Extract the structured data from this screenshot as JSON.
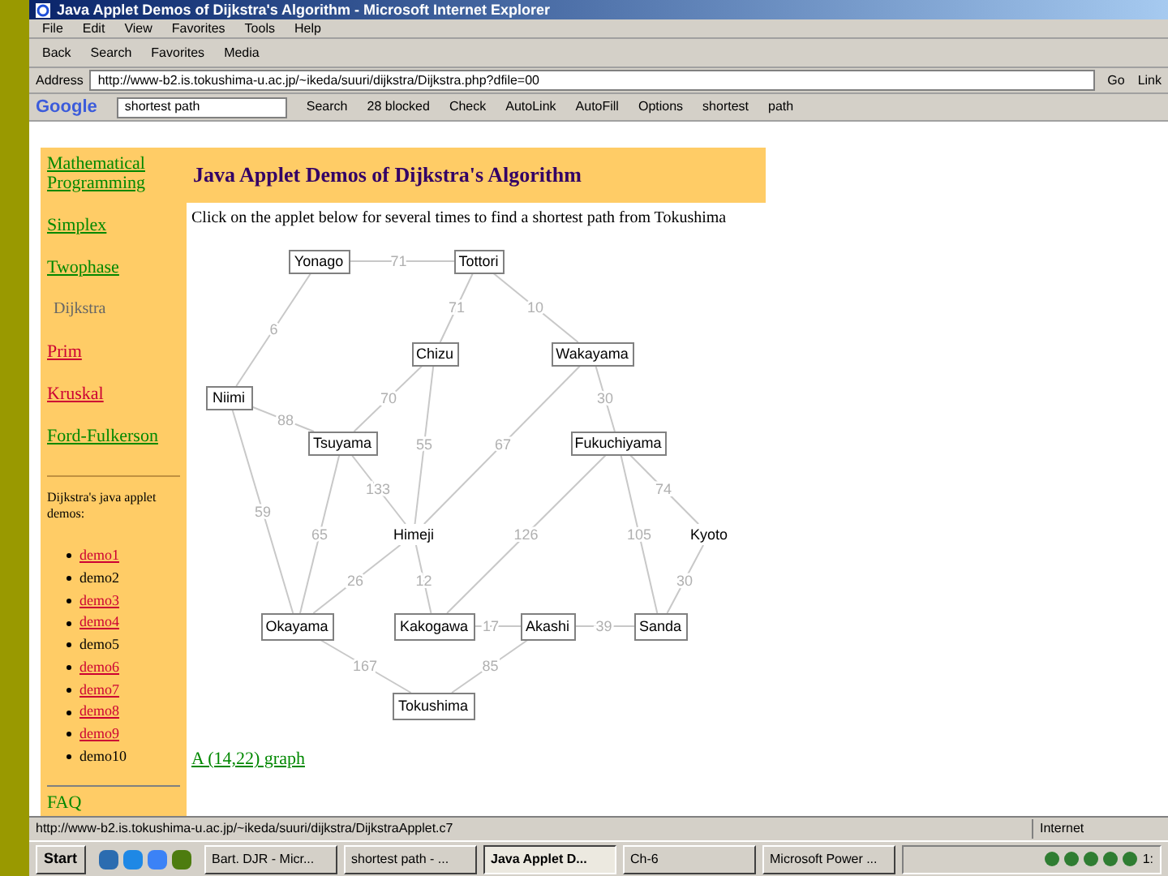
{
  "window": {
    "title": "Java Applet Demos of Dijkstra's Algorithm - Microsoft Internet Explorer"
  },
  "menu": [
    "File",
    "Edit",
    "View",
    "Favorites",
    "Tools",
    "Help"
  ],
  "toolbar": [
    "Back",
    "Search",
    "Favorites",
    "Media"
  ],
  "address": {
    "label": "Address",
    "value": "http://www-b2.is.tokushima-u.ac.jp/~ikeda/suuri/dijkstra/Dijkstra.php?dfile=00",
    "go": "Go",
    "links": "Link"
  },
  "google": {
    "logo": "Google",
    "query": "shortest path",
    "items": [
      "Search",
      "28 blocked",
      "Check",
      "AutoLink",
      "AutoFill",
      "Options",
      "shortest",
      "path"
    ]
  },
  "sidebar": {
    "items": [
      {
        "label": "Mathematical Programming",
        "kind": "link"
      },
      {
        "label": "Simplex",
        "kind": "link"
      },
      {
        "label": "Twophase",
        "kind": "link"
      },
      {
        "label": "Dijkstra",
        "kind": "current"
      },
      {
        "label": "Prim",
        "kind": "visited"
      },
      {
        "label": "Kruskal",
        "kind": "visited"
      },
      {
        "label": "Ford-Fulkerson",
        "kind": "link"
      }
    ],
    "demos_title": "Dijkstra's java applet demos:",
    "demos": [
      {
        "label": "demo1",
        "link": true
      },
      {
        "label": "demo2",
        "link": false
      },
      {
        "label": "demo3",
        "link": true
      },
      {
        "label": "demo4",
        "link": true
      },
      {
        "label": "demo5",
        "link": false
      },
      {
        "label": "demo6",
        "link": true
      },
      {
        "label": "demo7",
        "link": true
      },
      {
        "label": "demo8",
        "link": true
      },
      {
        "label": "demo9",
        "link": true
      },
      {
        "label": "demo10",
        "link": false
      }
    ],
    "faq": "FAQ"
  },
  "page": {
    "heading": "Java Applet Demos of Dijkstra's Algorithm",
    "intro": "Click on the applet below for several times to find a shortest path from Tokushima",
    "graph": {
      "nodes": [
        {
          "label": "Yonago",
          "kind": "boxed"
        },
        {
          "label": "Tottori",
          "kind": "boxed"
        },
        {
          "label": "Chizu",
          "kind": "boxed"
        },
        {
          "label": "Wakayama",
          "kind": "boxed"
        },
        {
          "label": "Niimi",
          "kind": "boxed"
        },
        {
          "label": "Tsuyama",
          "kind": "boxed"
        },
        {
          "label": "Fukuchiyama",
          "kind": "boxed"
        },
        {
          "label": "Himeji",
          "kind": "plain"
        },
        {
          "label": "Kyoto",
          "kind": "plain"
        },
        {
          "label": "Okayama",
          "kind": "boxed"
        },
        {
          "label": "Kakogawa",
          "kind": "boxed"
        },
        {
          "label": "Akashi",
          "kind": "boxed"
        },
        {
          "label": "Sanda",
          "kind": "boxed"
        },
        {
          "label": "Tokushima",
          "kind": "boxed"
        }
      ],
      "edges": [
        {
          "weight": "71"
        },
        {
          "weight": "71"
        },
        {
          "weight": "10"
        },
        {
          "weight": "6"
        },
        {
          "weight": "70"
        },
        {
          "weight": "30"
        },
        {
          "weight": "88"
        },
        {
          "weight": "55"
        },
        {
          "weight": "67"
        },
        {
          "weight": "133"
        },
        {
          "weight": "74"
        },
        {
          "weight": "59"
        },
        {
          "weight": "65"
        },
        {
          "weight": "126"
        },
        {
          "weight": "105"
        },
        {
          "weight": "26"
        },
        {
          "weight": "12"
        },
        {
          "weight": "30"
        },
        {
          "weight": "17"
        },
        {
          "weight": "39"
        },
        {
          "weight": "167"
        },
        {
          "weight": "85"
        }
      ]
    },
    "bottom_link": "A (14,22) graph"
  },
  "status_bar": {
    "url": "http://www-b2.is.tokushima-u.ac.jp/~ikeda/suuri/dijkstra/DijkstraApplet.c7",
    "zone": "Internet"
  },
  "taskbar": {
    "start": "Start",
    "tasks": [
      {
        "label": "Bart. DJR - Micr...",
        "selected": false
      },
      {
        "label": "shortest path - ...",
        "selected": false
      },
      {
        "label": "Java Applet D...",
        "selected": true
      },
      {
        "label": "Ch-6",
        "selected": false
      },
      {
        "label": "Microsoft Power ...",
        "selected": false
      }
    ],
    "clock": "1:"
  }
}
